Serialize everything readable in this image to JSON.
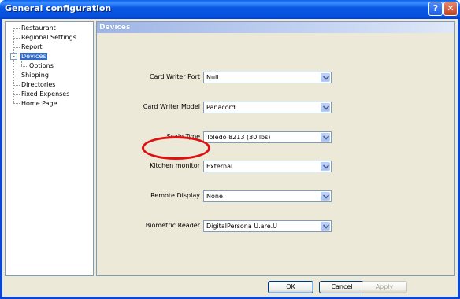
{
  "window": {
    "title": "General configuration"
  },
  "titlebar": {
    "help_glyph": "?",
    "close_glyph": "✕"
  },
  "tree": {
    "items": [
      {
        "label": "Restaurant"
      },
      {
        "label": "Regional Settings"
      },
      {
        "label": "Report"
      },
      {
        "label": "Devices",
        "selected": true,
        "expanded": true
      },
      {
        "label": "Options",
        "child": true
      },
      {
        "label": "Shipping"
      },
      {
        "label": "Directories"
      },
      {
        "label": "Fixed Expenses"
      },
      {
        "label": "Home Page"
      }
    ],
    "expander_glyph": "-"
  },
  "panel": {
    "header": "Devices",
    "fields": [
      {
        "label": "Card Writer Port",
        "value": "Null"
      },
      {
        "label": "Card Writer Model",
        "value": "Panacord"
      },
      {
        "label": "Scale Type",
        "value": "Toledo 8213 (30 lbs)"
      },
      {
        "label": "Kitchen monitor",
        "value": "External",
        "highlighted": true
      },
      {
        "label": "Remote Display",
        "value": "None"
      },
      {
        "label": "Biometric Reader",
        "value": "DigitalPersona U.are.U"
      }
    ]
  },
  "buttons": {
    "ok": "OK",
    "cancel": "Cancel",
    "apply": "Apply"
  },
  "colors": {
    "highlight": "#e01010",
    "selection": "#316ac5",
    "titlebar": "#0651dd"
  }
}
